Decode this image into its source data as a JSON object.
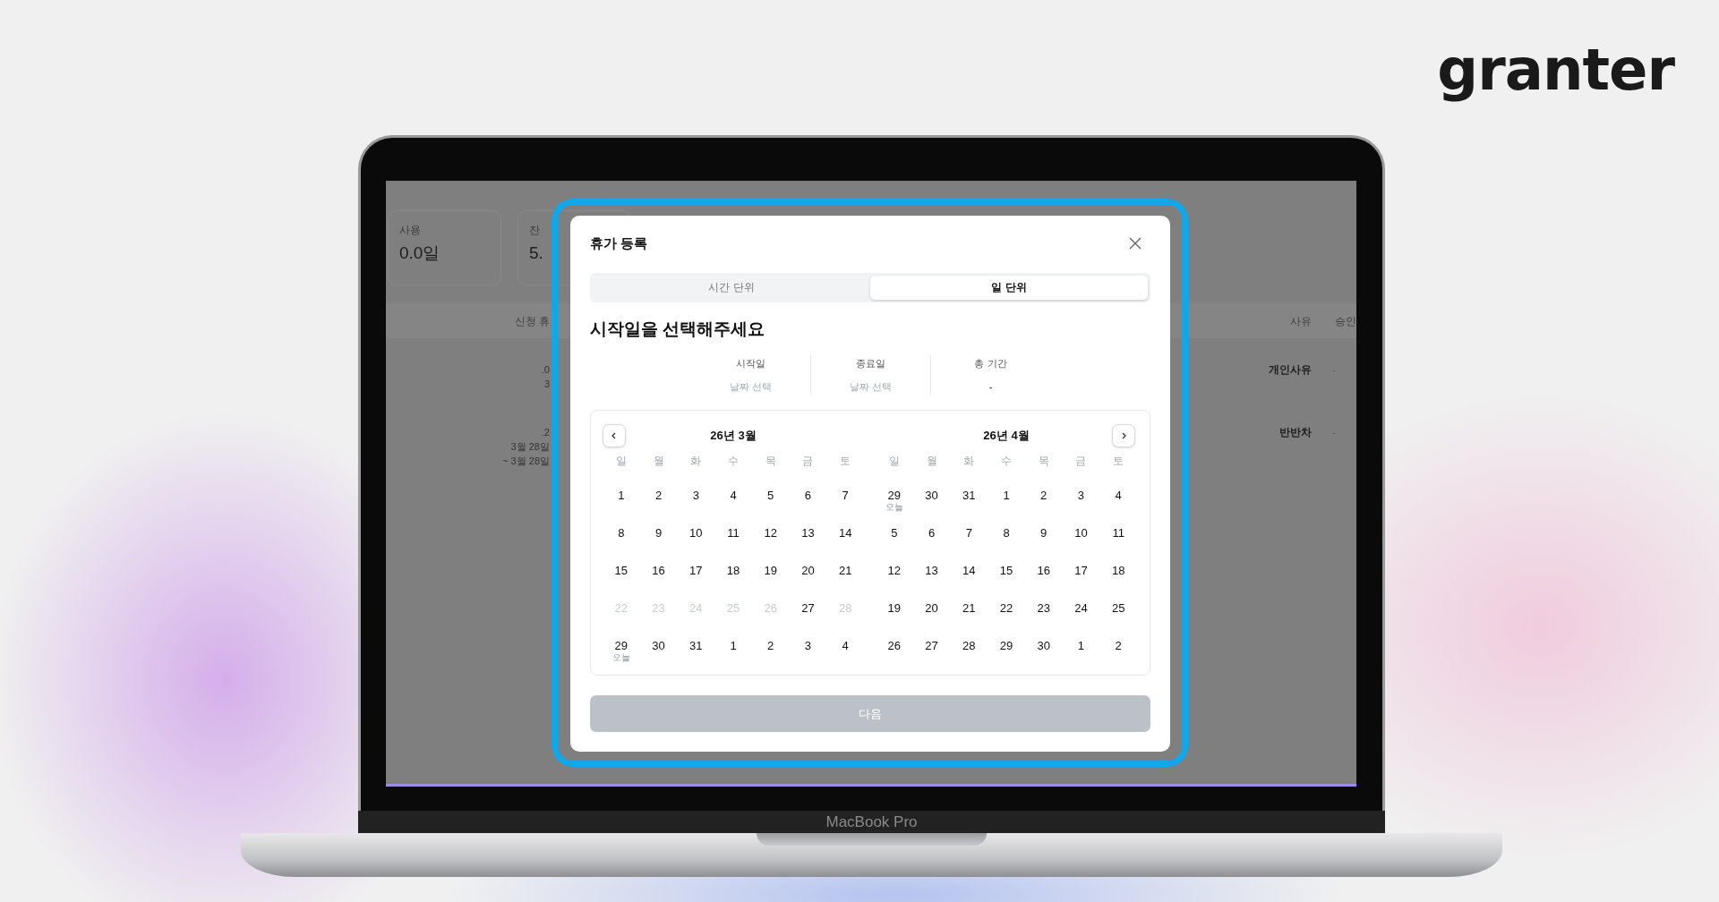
{
  "logo": "granter",
  "device_label": "MacBook Pro",
  "page": {
    "stats": [
      {
        "label": "사용",
        "value": "0.0일"
      },
      {
        "label": "잔",
        "value": "5."
      }
    ],
    "table": {
      "columns": [
        "신청 휴",
        "사유",
        "승인"
      ],
      "rows": [
        {
          "period": [
            ".0",
            "3"
          ],
          "reason": "개인사유",
          "status": "-"
        },
        {
          "period": [
            ".2",
            "3월 28일",
            "~ 3월 28일"
          ],
          "reason": "반반차",
          "status": "-"
        }
      ]
    }
  },
  "modal": {
    "title": "휴가 등록",
    "tabs": [
      {
        "label": "시간 단위",
        "selected": false
      },
      {
        "label": "일 단위",
        "selected": true
      }
    ],
    "heading": "시작일을 선택해주세요",
    "summary": [
      {
        "label": "시작일",
        "value": "날짜 선택",
        "kind": "placeholder"
      },
      {
        "label": "종료일",
        "value": "날짜 선택",
        "kind": "placeholder"
      },
      {
        "label": "총 기간",
        "value": "-",
        "kind": "value"
      }
    ],
    "months": [
      {
        "title": "26년 3월",
        "weekdays": [
          "일",
          "월",
          "화",
          "수",
          "목",
          "금",
          "토"
        ],
        "weeks": [
          [
            {
              "day": "1",
              "disabled": false
            },
            {
              "day": "2",
              "disabled": false
            },
            {
              "day": "3",
              "disabled": false
            },
            {
              "day": "4",
              "disabled": false
            },
            {
              "day": "5",
              "disabled": false
            },
            {
              "day": "6",
              "disabled": false
            },
            {
              "day": "7",
              "disabled": false
            }
          ],
          [
            {
              "day": "8",
              "disabled": false
            },
            {
              "day": "9",
              "disabled": false
            },
            {
              "day": "10",
              "disabled": false
            },
            {
              "day": "11",
              "disabled": false
            },
            {
              "day": "12",
              "disabled": false
            },
            {
              "day": "13",
              "disabled": false
            },
            {
              "day": "14",
              "disabled": false
            }
          ],
          [
            {
              "day": "15",
              "disabled": false
            },
            {
              "day": "16",
              "disabled": false
            },
            {
              "day": "17",
              "disabled": false
            },
            {
              "day": "18",
              "disabled": false
            },
            {
              "day": "19",
              "disabled": false
            },
            {
              "day": "20",
              "disabled": false
            },
            {
              "day": "21",
              "disabled": false
            }
          ],
          [
            {
              "day": "22",
              "disabled": true
            },
            {
              "day": "23",
              "disabled": true
            },
            {
              "day": "24",
              "disabled": true
            },
            {
              "day": "25",
              "disabled": true
            },
            {
              "day": "26",
              "disabled": true
            },
            {
              "day": "27",
              "disabled": false
            },
            {
              "day": "28",
              "disabled": true
            }
          ],
          [
            {
              "day": "29",
              "disabled": false,
              "note": "오늘"
            },
            {
              "day": "30",
              "disabled": false
            },
            {
              "day": "31",
              "disabled": false
            },
            {
              "day": "1",
              "disabled": false
            },
            {
              "day": "2",
              "disabled": false
            },
            {
              "day": "3",
              "disabled": false
            },
            {
              "day": "4",
              "disabled": false
            }
          ]
        ]
      },
      {
        "title": "26년 4월",
        "weekdays": [
          "일",
          "월",
          "화",
          "수",
          "목",
          "금",
          "토"
        ],
        "weeks": [
          [
            {
              "day": "29",
              "disabled": false,
              "note": "오늘"
            },
            {
              "day": "30",
              "disabled": false
            },
            {
              "day": "31",
              "disabled": false
            },
            {
              "day": "1",
              "disabled": false
            },
            {
              "day": "2",
              "disabled": false
            },
            {
              "day": "3",
              "disabled": false
            },
            {
              "day": "4",
              "disabled": false
            }
          ],
          [
            {
              "day": "5",
              "disabled": false
            },
            {
              "day": "6",
              "disabled": false
            },
            {
              "day": "7",
              "disabled": false
            },
            {
              "day": "8",
              "disabled": false
            },
            {
              "day": "9",
              "disabled": false
            },
            {
              "day": "10",
              "disabled": false
            },
            {
              "day": "11",
              "disabled": false
            }
          ],
          [
            {
              "day": "12",
              "disabled": false
            },
            {
              "day": "13",
              "disabled": false
            },
            {
              "day": "14",
              "disabled": false
            },
            {
              "day": "15",
              "disabled": false
            },
            {
              "day": "16",
              "disabled": false
            },
            {
              "day": "17",
              "disabled": false
            },
            {
              "day": "18",
              "disabled": false
            }
          ],
          [
            {
              "day": "19",
              "disabled": false
            },
            {
              "day": "20",
              "disabled": false
            },
            {
              "day": "21",
              "disabled": false
            },
            {
              "day": "22",
              "disabled": false
            },
            {
              "day": "23",
              "disabled": false
            },
            {
              "day": "24",
              "disabled": false
            },
            {
              "day": "25",
              "disabled": false
            }
          ],
          [
            {
              "day": "26",
              "disabled": false
            },
            {
              "day": "27",
              "disabled": false
            },
            {
              "day": "28",
              "disabled": false
            },
            {
              "day": "29",
              "disabled": false
            },
            {
              "day": "30",
              "disabled": false
            },
            {
              "day": "1",
              "disabled": false
            },
            {
              "day": "2",
              "disabled": false
            }
          ]
        ]
      }
    ],
    "next_button": {
      "label": "다음",
      "disabled": true
    }
  }
}
